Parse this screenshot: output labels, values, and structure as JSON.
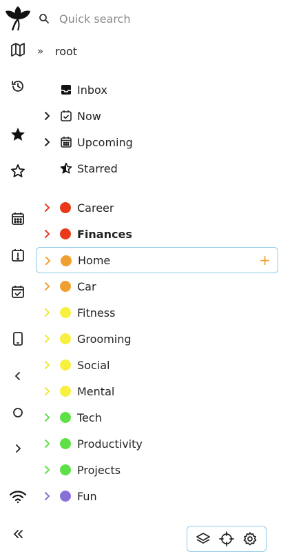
{
  "search": {
    "placeholder": "Quick search"
  },
  "breadcrumb": {
    "root_label": "root"
  },
  "tree": {
    "system": [
      {
        "label": "Inbox",
        "icon": "inbox-icon"
      },
      {
        "label": "Now",
        "icon": "calendar-check-icon",
        "expandable": true
      },
      {
        "label": "Upcoming",
        "icon": "calendar-icon",
        "expandable": true
      },
      {
        "label": "Starred",
        "icon": "star-half-icon"
      }
    ],
    "items": [
      {
        "label": "Career",
        "color": "#e8391a"
      },
      {
        "label": "Finances",
        "color": "#e8391a",
        "bold": true
      },
      {
        "label": "Home",
        "color": "#f0a030",
        "selected": true
      },
      {
        "label": "Car",
        "color": "#f0a030"
      },
      {
        "label": "Fitness",
        "color": "#f7f040"
      },
      {
        "label": "Grooming",
        "color": "#f7f040"
      },
      {
        "label": "Social",
        "color": "#f7f040"
      },
      {
        "label": "Mental",
        "color": "#f7f040"
      },
      {
        "label": "Tech",
        "color": "#60e048"
      },
      {
        "label": "Productivity",
        "color": "#60e048"
      },
      {
        "label": "Projects",
        "color": "#60e048"
      },
      {
        "label": "Fun",
        "color": "#8870d8"
      }
    ],
    "add_glyph": "+"
  },
  "rail_icons": [
    "logo-icon",
    "map-icon",
    "history-icon",
    "star-filled-icon",
    "star-outline-icon",
    "calendar-icon",
    "alert-calendar-icon",
    "calendar-check-icon",
    "mobile-icon",
    "back-icon",
    "home-circle-icon",
    "forward-icon",
    "wifi-icon",
    "collapse-icon"
  ],
  "toolbar_icons": [
    "layers-icon",
    "target-icon",
    "gear-icon"
  ],
  "colors": {
    "selection_border": "#8cc8e8",
    "add_accent": "#f0a030"
  }
}
